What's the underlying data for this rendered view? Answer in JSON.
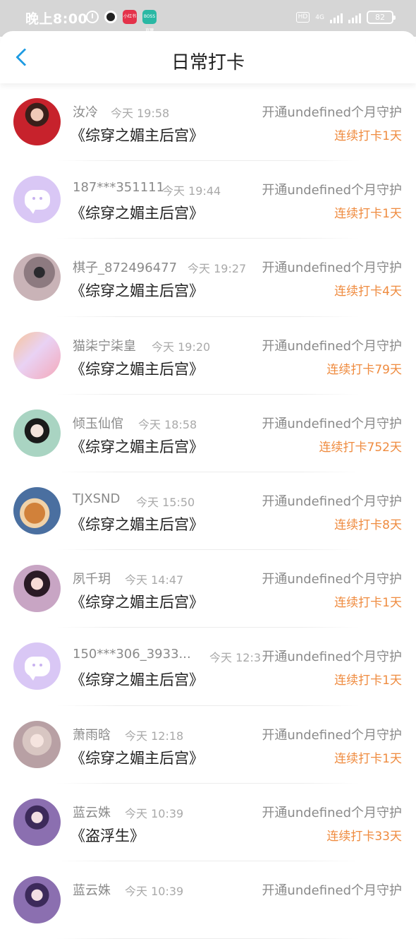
{
  "status_bar": {
    "time": "晚上8:00",
    "app_badge_1": "小红书",
    "app_badge_2": "BOSS直聘",
    "hd": "HD",
    "network": "4G",
    "battery": "82"
  },
  "header": {
    "title": "日常打卡"
  },
  "colors": {
    "accent": "#1e9be2",
    "streak": "#ef8b3f",
    "muted": "#8a8a8a",
    "avatar_default": "#d9c7f5"
  },
  "list": [
    {
      "username": "汝冷",
      "time": "今天 19:58",
      "title": "《综穿之媚主后宫》",
      "guard": "开通undefined个月守护",
      "streak": "连续打卡1天",
      "avatar": "photo"
    },
    {
      "username": "187***351111",
      "time": "今天 19:44",
      "title": "《综穿之媚主后宫》",
      "guard": "开通undefined个月守护",
      "streak": "连续打卡1天",
      "avatar": "default"
    },
    {
      "username": "棋子_872496477",
      "time": "今天 19:27",
      "title": "《综穿之媚主后宫》",
      "guard": "开通undefined个月守护",
      "streak": "连续打卡4天",
      "avatar": "photo"
    },
    {
      "username": "猫柒宁柒皇",
      "time": "今天 19:20",
      "title": "《综穿之媚主后宫》",
      "guard": "开通undefined个月守护",
      "streak": "连续打卡79天",
      "avatar": "photo"
    },
    {
      "username": "倾玉仙倌",
      "time": "今天 18:58",
      "title": "《综穿之媚主后宫》",
      "guard": "开通undefined个月守护",
      "streak": "连续打卡752天",
      "avatar": "photo"
    },
    {
      "username": "TJXSND",
      "time": "今天 15:50",
      "title": "《综穿之媚主后宫》",
      "guard": "开通undefined个月守护",
      "streak": "连续打卡8天",
      "avatar": "photo"
    },
    {
      "username": "夙千玥",
      "time": "今天 14:47",
      "title": "《综穿之媚主后宫》",
      "guard": "开通undefined个月守护",
      "streak": "连续打卡1天",
      "avatar": "photo"
    },
    {
      "username": "150***306_3933...",
      "time": "今天 12:3",
      "title": "《综穿之媚主后宫》",
      "guard": "开通undefined个月守护",
      "streak": "连续打卡1天",
      "avatar": "default"
    },
    {
      "username": "萧雨晗",
      "time": "今天 12:18",
      "title": "《综穿之媚主后宫》",
      "guard": "开通undefined个月守护",
      "streak": "连续打卡1天",
      "avatar": "photo"
    },
    {
      "username": "蓝云姝",
      "time": "今天 10:39",
      "title": "《盗浮生》",
      "guard": "开通undefined个月守护",
      "streak": "连续打卡33天",
      "avatar": "photo"
    },
    {
      "username": "蓝云姝",
      "time": "今天 10:39",
      "title": "",
      "guard": "开通undefined个月守护",
      "streak": "",
      "avatar": "photo"
    }
  ]
}
